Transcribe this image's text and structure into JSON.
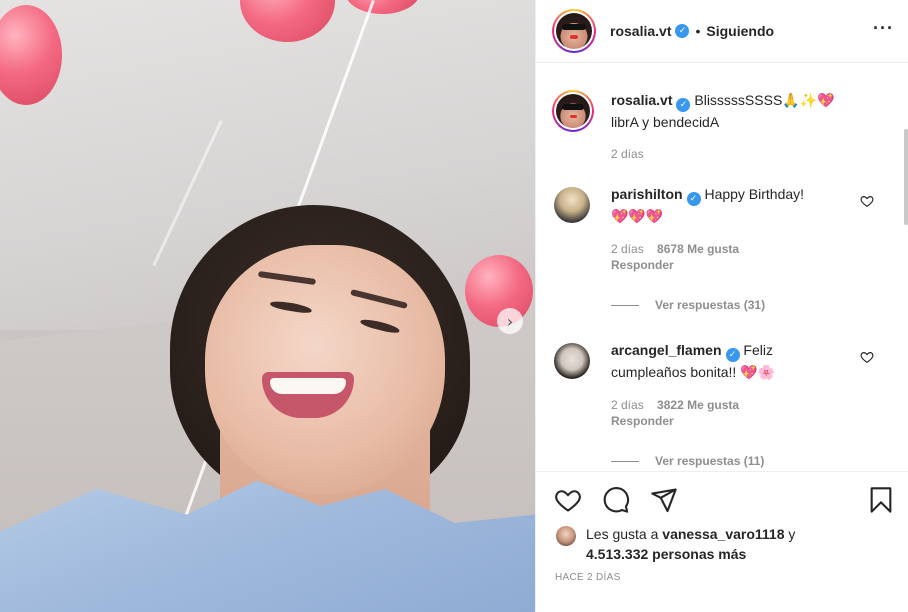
{
  "post": {
    "username": "rosalia.vt",
    "follow_status": "Siguiendo",
    "more_icon": "ellipsis-icon"
  },
  "caption": {
    "username": "rosalia.vt",
    "text_line1": "BlisssssSSSS",
    "emojis_line1": "🙏✨💖",
    "text_line2": "librA y bendecidA",
    "time": "2 días"
  },
  "comments": [
    {
      "username": "parishilton",
      "text": "Happy Birthday!",
      "emojis": "💖💖💖",
      "time": "2 días",
      "likes": "8678 Me gusta",
      "reply": "Responder",
      "view_replies": "Ver respuestas (31)"
    },
    {
      "username": "arcangel_flamen",
      "text": "Feliz cumpleaños bonita!!",
      "emojis": "💖🌸",
      "time": "2 días",
      "likes": "3822 Me gusta",
      "reply": "Responder",
      "view_replies": "Ver respuestas (11)"
    }
  ],
  "likes_summary": {
    "prefix": "Les gusta a",
    "user": "vanessa_varo1118",
    "connector": "y",
    "others": "4.513.332 personas más"
  },
  "timestamp": "HACE 2 DÍAS",
  "colors": {
    "verified": "#3897f0",
    "meta_grey": "#8e8e8e",
    "text": "#262626"
  }
}
